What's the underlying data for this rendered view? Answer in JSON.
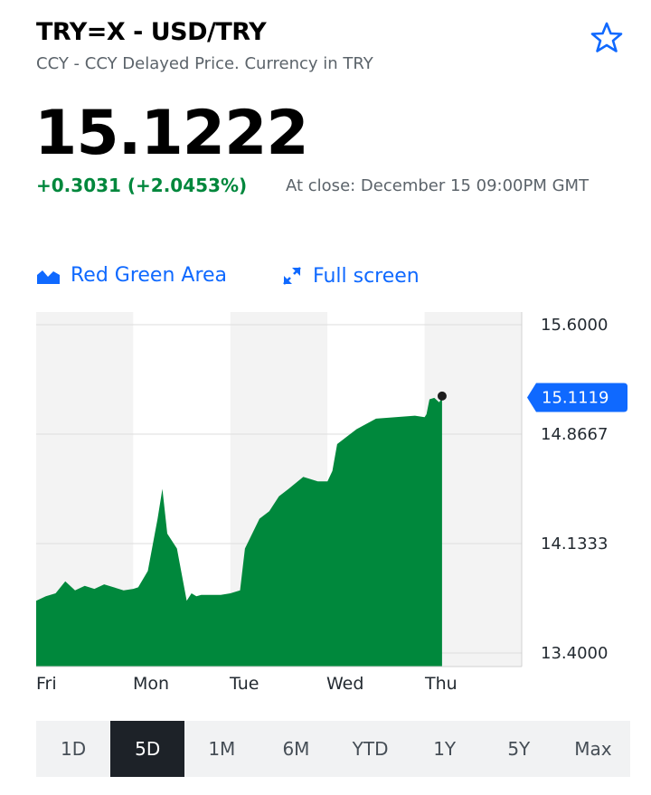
{
  "header": {
    "title": "TRY=X - USD/TRY",
    "subtitle": "CCY - CCY Delayed Price. Currency in TRY"
  },
  "quote": {
    "price": "15.1222",
    "change": "+0.3031 (+2.0453%)",
    "close_time": "At close: December 15 09:00PM GMT"
  },
  "toolbar": {
    "chart_type_label": "Red Green Area",
    "fullscreen_label": "Full screen"
  },
  "colors": {
    "accent": "#0f69ff",
    "positive": "#00873c",
    "area_fill": "#00883c"
  },
  "chart_data": {
    "type": "area",
    "x_labels": [
      "Fri",
      "Mon",
      "Tue",
      "Wed",
      "Thu"
    ],
    "y_ticks": [
      "15.6000",
      "14.8667",
      "14.1333",
      "13.4000"
    ],
    "ylim": [
      13.4,
      15.6
    ],
    "current_value": "15.1119",
    "series": [
      {
        "x": [
          0,
          0.1,
          0.2,
          0.3,
          0.4,
          0.5,
          0.6,
          0.7,
          0.8,
          0.9,
          1.0,
          1.05,
          1.15,
          1.25,
          1.3,
          1.35,
          1.45,
          1.55,
          1.6,
          1.65,
          1.7,
          1.8,
          1.9,
          2.0,
          2.1,
          2.15,
          2.3,
          2.4,
          2.5,
          2.6,
          2.75,
          2.9,
          3.0,
          3.05,
          3.1,
          3.3,
          3.5,
          3.7,
          3.9,
          4.0,
          4.02,
          4.05,
          4.1,
          4.15,
          4.18
        ],
        "y": [
          13.75,
          13.78,
          13.8,
          13.88,
          13.82,
          13.85,
          13.83,
          13.86,
          13.84,
          13.82,
          13.83,
          13.84,
          13.95,
          14.3,
          14.5,
          14.2,
          14.1,
          13.75,
          13.8,
          13.78,
          13.79,
          13.79,
          13.79,
          13.8,
          13.82,
          14.1,
          14.3,
          14.35,
          14.45,
          14.5,
          14.58,
          14.55,
          14.55,
          14.62,
          14.8,
          14.9,
          14.97,
          14.98,
          14.99,
          14.98,
          15.0,
          15.1,
          15.11,
          15.08,
          15.11
        ]
      }
    ]
  },
  "ranges": [
    "1D",
    "5D",
    "1M",
    "6M",
    "YTD",
    "1Y",
    "5Y",
    "Max"
  ],
  "active_range": "5D"
}
